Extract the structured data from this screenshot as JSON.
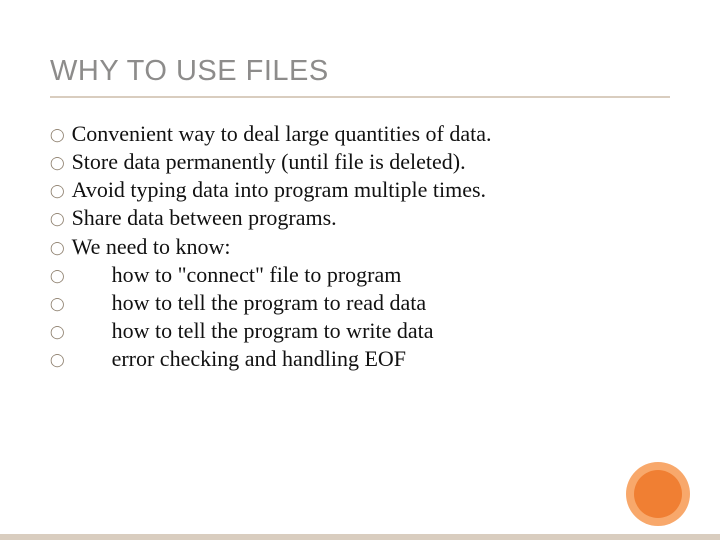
{
  "title": "WHY TO USE FILES",
  "bullets": {
    "b0": "Convenient way to deal large quantities of data.",
    "b1": "Store data permanently (until file is deleted).",
    "b2": "Avoid typing data into program multiple times.",
    "b3": "Share data between programs.",
    "b4": "We need to know:",
    "b5": "how to \"connect\" file to program",
    "b6": "how to tell the program to read data",
    "b7": "how to tell the program to write data",
    "b8": "error checking and handling EOF"
  }
}
